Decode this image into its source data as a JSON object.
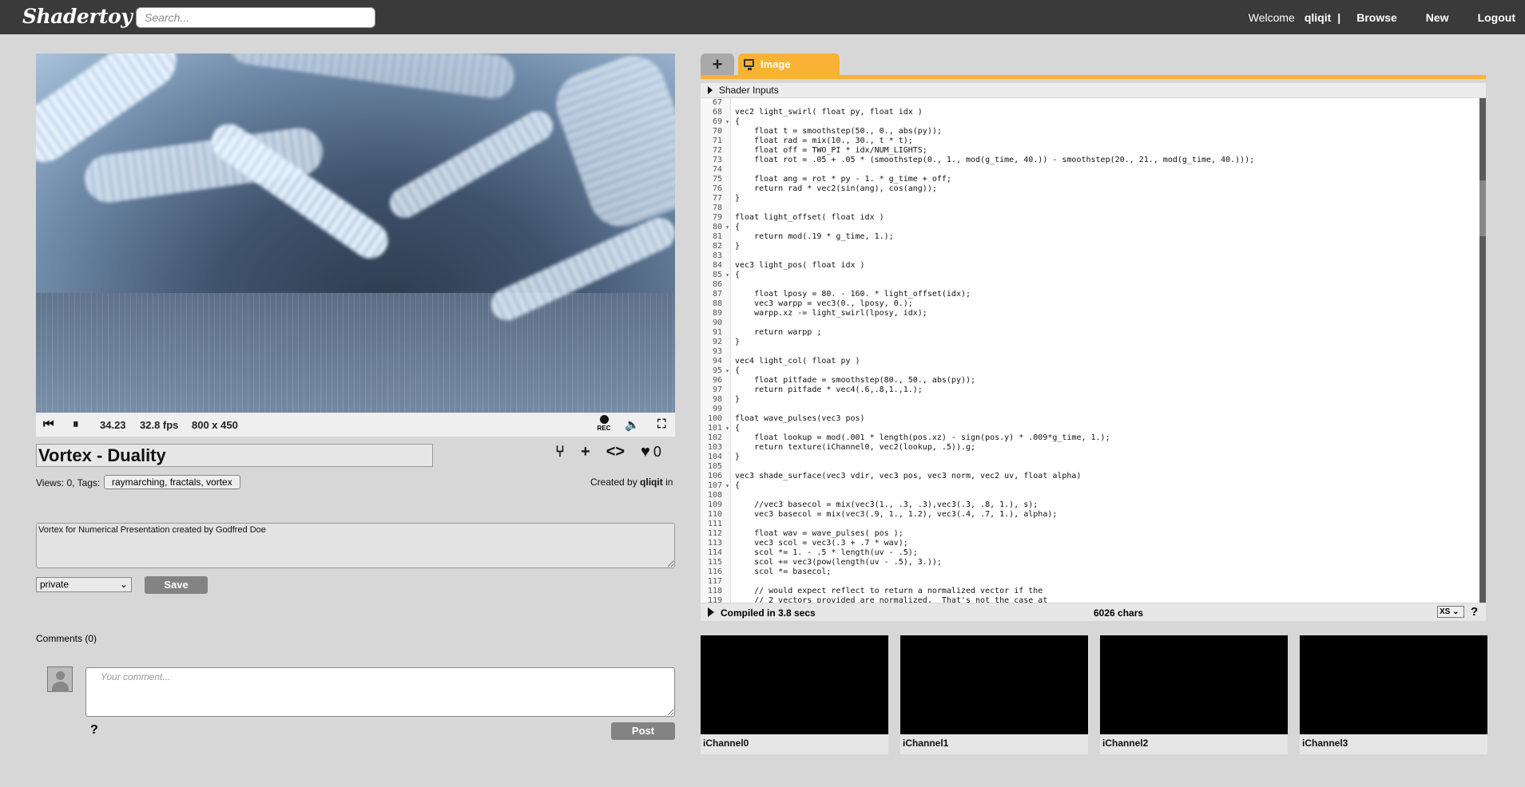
{
  "header": {
    "logo": "Shadertoy",
    "search_placeholder": "Search...",
    "welcome": "Welcome",
    "username": "qliqit",
    "separator": "|",
    "nav": [
      "Browse",
      "New",
      "Logout"
    ]
  },
  "player": {
    "time": "34.23",
    "fps": "32.8 fps",
    "resolution": "800 x 450",
    "rec_label": "REC"
  },
  "shader": {
    "title": "Vortex - Duality",
    "likes": "0",
    "views": "Views: 0, Tags:",
    "tags": "raymarching, fractals, vortex",
    "created_prefix": "Created by",
    "created_user": "qliqit",
    "created_suffix": "in",
    "description": "Vortex for Numerical Presentation created by Godfred Doe",
    "privacy": "private",
    "save_label": "Save"
  },
  "comments": {
    "title": "Comments (0)",
    "placeholder": "Your comment...",
    "help": "?",
    "post_label": "Post"
  },
  "editor": {
    "tab_add": "+",
    "tab_image": "Image",
    "shader_inputs": "Shader Inputs",
    "compiled": "Compiled in 3.8 secs",
    "chars": "6026 chars",
    "font_size": "XS",
    "help": "?",
    "line_numbers": [
      "67",
      "68",
      "69",
      "70",
      "71",
      "72",
      "73",
      "74",
      "75",
      "76",
      "77",
      "78",
      "79",
      "80",
      "81",
      "82",
      "83",
      "84",
      "85",
      "86",
      "87",
      "88",
      "89",
      "90",
      "91",
      "92",
      "93",
      "94",
      "95",
      "96",
      "97",
      "98",
      "99",
      "100",
      "101",
      "102",
      "103",
      "104",
      "105",
      "106",
      "107",
      "108",
      "109",
      "110",
      "111",
      "112",
      "113",
      "114",
      "115",
      "116",
      "117",
      "118",
      "119"
    ],
    "fold_lines": [
      "69",
      "80",
      "85",
      "95",
      "101",
      "107"
    ],
    "code": [
      "",
      "vec2 light_swirl( float py, float idx )",
      "{",
      "    float t = smoothstep(50., 0., abs(py));",
      "    float rad = mix(10., 30., t * t);",
      "    float off = TWO_PI * idx/NUM_LIGHTS;",
      "    float rot = .05 + .05 * (smoothstep(0., 1., mod(g_time, 40.)) - smoothstep(20., 21., mod(g_time, 40.)));",
      "",
      "    float ang = rot * py - 1. * g_time + off;",
      "    return rad * vec2(sin(ang), cos(ang));",
      "}",
      "",
      "float light_offset( float idx )",
      "{",
      "    return mod(.19 * g_time, 1.);",
      "}",
      "",
      "vec3 light_pos( float idx )",
      "{",
      "",
      "    float lposy = 80. - 160. * light_offset(idx);",
      "    vec3 warpp = vec3(0., lposy, 0.);",
      "    warpp.xz -= light_swirl(lposy, idx);",
      "",
      "    return warpp ;",
      "}",
      "",
      "vec4 light_col( float py )",
      "{",
      "    float pitfade = smoothstep(80., 50., abs(py));",
      "    return pitfade * vec4(.6,.8,1.,1.);",
      "}",
      "",
      "float wave_pulses(vec3 pos)",
      "{",
      "    float lookup = mod(.001 * length(pos.xz) - sign(pos.y) * .009*g_time, 1.);",
      "    return texture(iChannel0, vec2(lookup, .5)).g;",
      "}",
      "",
      "vec3 shade_surface(vec3 vdir, vec3 pos, vec3 norm, vec2 uv, float alpha)",
      "{",
      "",
      "    //vec3 basecol = mix(vec3(1., .3, .3),vec3(.3, .8, 1.), s);",
      "    vec3 basecol = mix(vec3(.9, 1., 1.2), vec3(.4, .7, 1.), alpha);",
      "",
      "    float wav = wave_pulses( pos );",
      "    vec3 scol = vec3(.3 + .7 * wav);",
      "    scol *= 1. - .5 * length(uv - .5);",
      "    scol += vec3(pow(length(uv - .5), 3.));",
      "    scol *= basecol;",
      "",
      "    // would expect reflect to return a normalized vector if the",
      "    // 2 vectors provided are normalized.  That's not the case at"
    ]
  },
  "channels": [
    "iChannel0",
    "iChannel1",
    "iChannel2",
    "iChannel3"
  ],
  "colors": {
    "topbar": "#3a3a3a",
    "tab_accent": "#f9b233",
    "button": "#838383"
  }
}
